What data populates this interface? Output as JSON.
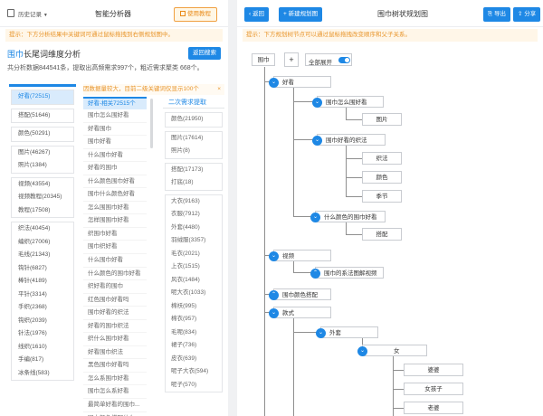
{
  "left": {
    "history": "历史记录",
    "title": "智能分析器",
    "tutorial_btn": "使用教程",
    "notice": "提示：下方分析结果中关键词可通过鼠标拖拽到右侧规划图中。",
    "keyword": "围巾",
    "heading_rest": "长尾词维度分析",
    "back_search": "返回搜索",
    "stats": "共分析数据844541条，提取出高频需求997个，粗近需求聚类 668个。",
    "col1_groups": [
      [
        "好看(72515)"
      ],
      [
        "搭配(51646)"
      ],
      [
        "颜色(50291)"
      ],
      [
        "图片(46267)",
        "照片(1384)"
      ],
      [
        "视频(43554)",
        "视频教程(20345)",
        "教程(17508)"
      ],
      [
        "织法(40454)",
        "编织(27006)",
        "毛线(21343)",
        "钩针(6827)",
        "棒针(4189)",
        "平针(3314)",
        "手织(2368)",
        "钩织(2039)",
        "针法(1976)",
        "线织(1610)",
        "手编(817)",
        "冰条线(583)"
      ]
    ],
    "col2_banner": "因数据量较大，目前二级关键词仅显示100个",
    "col2_close": "×",
    "col2_header": "好看-相关72515个",
    "col2_items": [
      "围巾怎么围好看",
      "好看围巾",
      "围巾好看",
      "什么围巾好看",
      "好看的围巾",
      "什么颜色围巾好看",
      "围巾什么颜色好看",
      "怎么围围巾好看",
      "怎样围围巾好看",
      "织围巾好看",
      "围巾织好看",
      "什么围巾好看",
      "什么颜色的围巾好看",
      "织好看的围巾",
      "红色围巾好看吗",
      "围巾好看的织法",
      "好看的围巾织法",
      "织什么围巾好看",
      "好看围巾织法",
      "黑色围巾好看吗",
      "怎么系围巾好看",
      "围巾怎么系好看",
      "最简单好看的围巾...",
      "围巾颜色搭配什么..."
    ],
    "col3_header": "二次需求提取",
    "col3_groups": [
      [
        "颜色(21950)"
      ],
      [
        "图片(17614)",
        "照片(8)"
      ],
      [
        "搭配(17173)",
        "打底(18)"
      ],
      [
        "大衣(9163)",
        "衣服(7912)",
        "外套(4480)",
        "羽绒服(3357)",
        "毛衣(2021)",
        "上衣(1515)",
        "风衣(1484)",
        "呢大衣(1033)",
        "棉袄(995)",
        "棉衣(957)",
        "毛呢(834)",
        "裙子(736)",
        "皮衣(639)",
        "呢子大衣(594)",
        "呢子(570)"
      ]
    ]
  },
  "right": {
    "back": "返回",
    "new_plan": "新建规划图",
    "title": "围巾树状规划图",
    "export": "导出",
    "share": "分享",
    "notice": "提示：下方规划树节点可以通过鼠标拖拽改变顺序和父子关系。",
    "root": "围巾",
    "add": "+",
    "expand_all": "全部展开",
    "nodes": {
      "n1": "好看",
      "n2": "围巾怎么围好看",
      "n3": "图片",
      "n4": "围巾好看的织法",
      "n5": "织法",
      "n6": "颜色",
      "n7": "季节",
      "n8": "什么颜色的围巾好看",
      "n9": "搭配",
      "n10": "视频",
      "n11": "围巾的系法图解视频",
      "n12": "围巾颜色搭配",
      "n13": "款式",
      "n14": "外套",
      "n15": "女",
      "n16": "婆婆",
      "n17": "女孩子",
      "n18": "老婆"
    }
  }
}
